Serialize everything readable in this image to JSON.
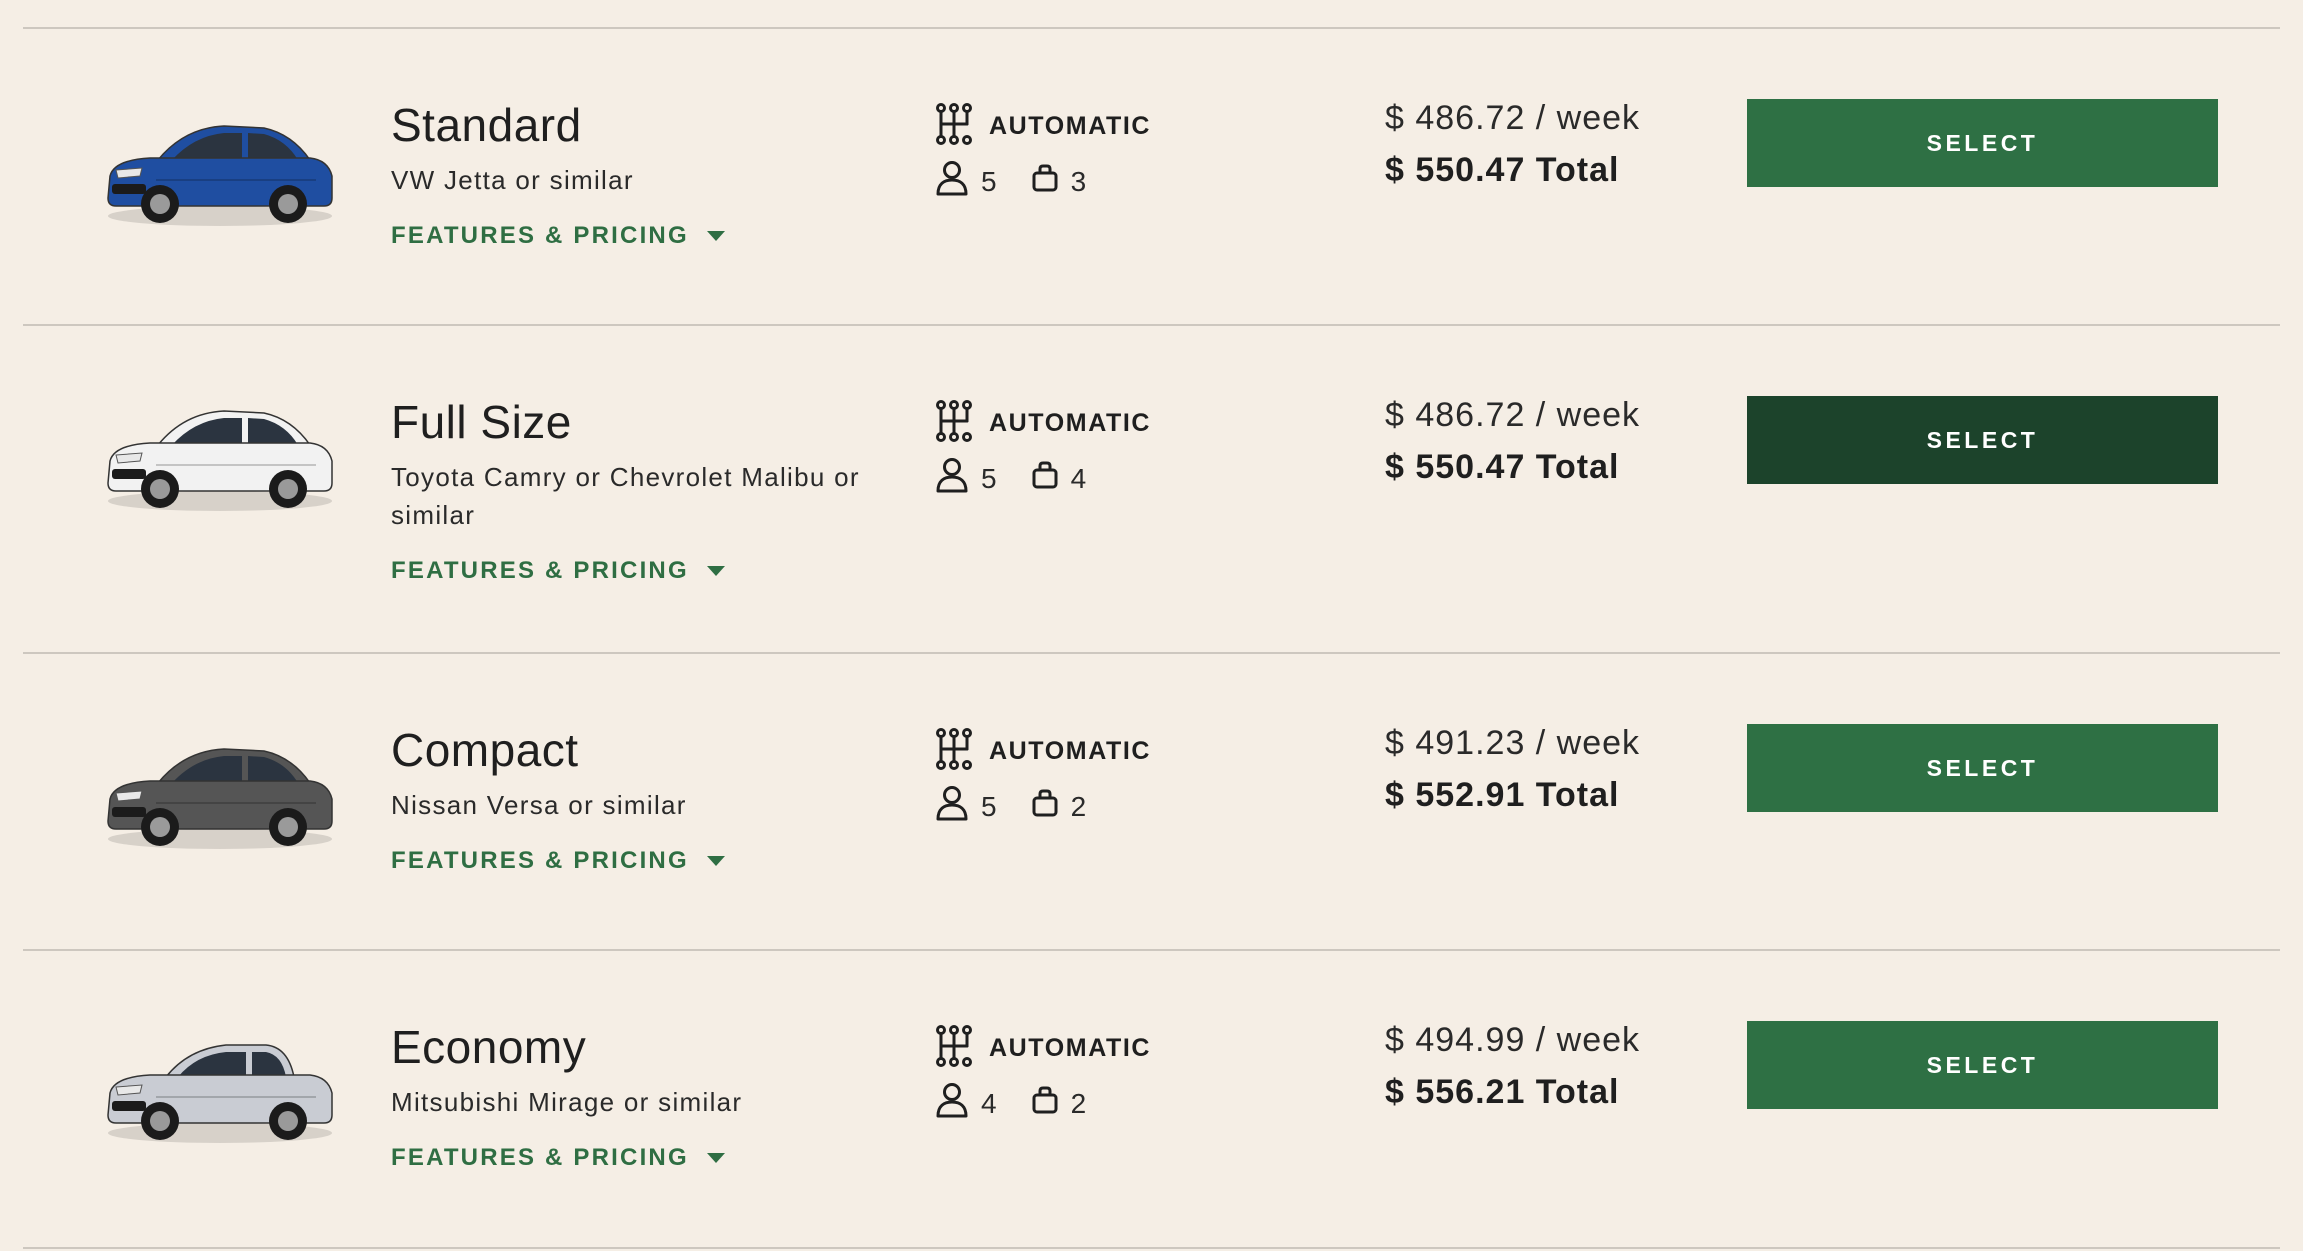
{
  "colors": {
    "page_background": "#f5eee5",
    "accent_green": "#2e7044",
    "button_hover_green": "#1c432b",
    "link_green": "#2f6e43",
    "divider": "#cdc7bf"
  },
  "vehicles": [
    {
      "title": "Standard",
      "subtitle": "VW Jetta or similar",
      "features_label": "FEATURES & PRICING",
      "transmission": "AUTOMATIC",
      "passengers": "5",
      "bags": "3",
      "price_week": "$ 486.72 / week",
      "price_total": "$ 550.47 Total",
      "select_label": "SELECT",
      "image_icon": "car-image",
      "car_color": "#1f4ea1",
      "body_style": "sedan",
      "button_state": "default"
    },
    {
      "title": "Full Size",
      "subtitle": "Toyota Camry or Chevrolet Malibu or similar",
      "features_label": "FEATURES & PRICING",
      "transmission": "AUTOMATIC",
      "passengers": "5",
      "bags": "4",
      "price_week": "$ 486.72 / week",
      "price_total": "$ 550.47 Total",
      "select_label": "SELECT",
      "image_icon": "car-image",
      "car_color": "#f2f2f2",
      "body_style": "sedan",
      "button_state": "hover"
    },
    {
      "title": "Compact",
      "subtitle": "Nissan Versa or similar",
      "features_label": "FEATURES & PRICING",
      "transmission": "AUTOMATIC",
      "passengers": "5",
      "bags": "2",
      "price_week": "$ 491.23 / week",
      "price_total": "$ 552.91 Total",
      "select_label": "SELECT",
      "image_icon": "car-image",
      "car_color": "#555555",
      "body_style": "sedan",
      "button_state": "default"
    },
    {
      "title": "Economy",
      "subtitle": "Mitsubishi Mirage or similar",
      "features_label": "FEATURES & PRICING",
      "transmission": "AUTOMATIC",
      "passengers": "4",
      "bags": "2",
      "price_week": "$ 494.99 / week",
      "price_total": "$ 556.21 Total",
      "select_label": "SELECT",
      "image_icon": "car-image",
      "car_color": "#c9ccd3",
      "body_style": "hatchback",
      "button_state": "default"
    }
  ]
}
